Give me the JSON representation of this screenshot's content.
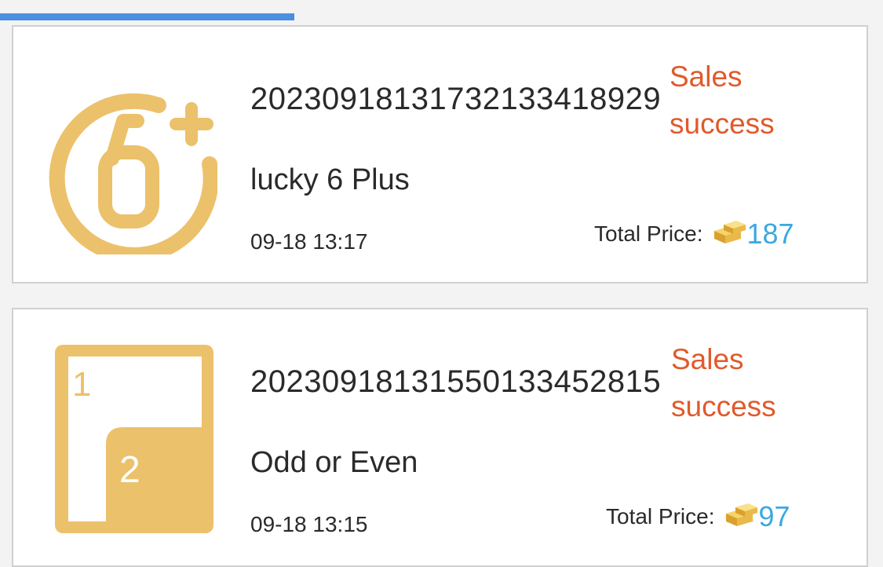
{
  "progress": {
    "fraction": 0.333,
    "color": "#4a90e2"
  },
  "orders": [
    {
      "order_id": "20230918131732133418929",
      "status": "Sales success",
      "game_name": "lucky 6 Plus",
      "date": "09-18 13:17",
      "price_label": "Total Price:",
      "price_value": "187",
      "icon": "lucky-6-plus-icon"
    },
    {
      "order_id": "20230918131550133452815",
      "status": "Sales success",
      "game_name": "Odd or Even",
      "date": "09-18 13:15",
      "price_label": "Total Price:",
      "price_value": "97",
      "icon": "odd-or-even-icon"
    }
  ],
  "icon_text": {
    "six": "6",
    "odd_even_one": "1",
    "odd_even_two": "2"
  },
  "colors": {
    "icon_gold": "#ecc16b",
    "status": "#e05a2b",
    "price": "#3aa8e0"
  }
}
